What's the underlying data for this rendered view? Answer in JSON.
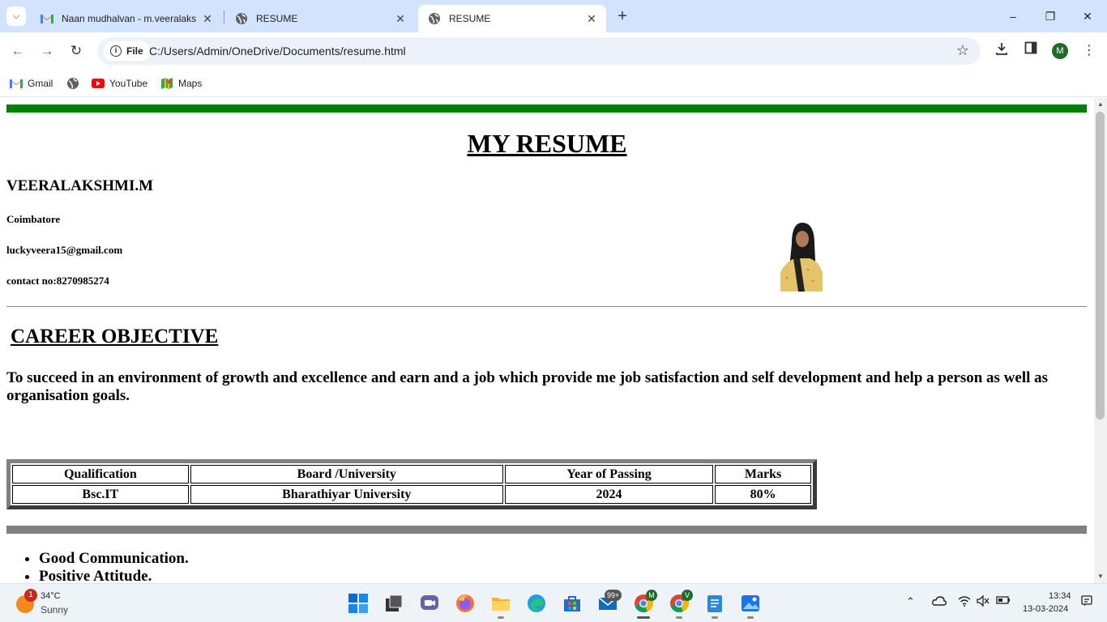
{
  "browser": {
    "tabs": [
      {
        "title": "Naan mudhalvan - m.veeralaksh",
        "favicon": "gmail-icon",
        "active": false
      },
      {
        "title": "RESUME",
        "favicon": "globe-icon",
        "active": false
      },
      {
        "title": "RESUME",
        "favicon": "globe-icon",
        "active": true
      }
    ],
    "omnibox": {
      "chip_label": "File",
      "url": "C:/Users/Admin/OneDrive/Documents/resume.html"
    },
    "profile_initial": "M",
    "bookmarks": [
      {
        "label": "Gmail",
        "icon": "gmail-icon"
      },
      {
        "label": "",
        "icon": "globe-icon"
      },
      {
        "label": "YouTube",
        "icon": "youtube-icon"
      },
      {
        "label": "Maps",
        "icon": "maps-icon"
      }
    ]
  },
  "resume": {
    "title": "MY RESUME",
    "name": "VEERALAKSHMI.M",
    "city": "Coimbatore",
    "email": "luckyveera15@gmail.com",
    "contact": "contact no:8270985274",
    "career_heading": "CAREER OBJECTIVE",
    "objective": "To succeed in an environment of growth and excellence and earn and a job which provide me job satisfaction and self development and help a person as well as organisation goals.",
    "table": {
      "headers": [
        "Qualification",
        "Board /University",
        "Year of Passing",
        "Marks"
      ],
      "rows": [
        [
          "Bsc.IT",
          "Bharathiyar University",
          "2024",
          "80%"
        ]
      ]
    },
    "skills": [
      "Good Communication.",
      "Positive Attitude."
    ],
    "colors": {
      "top_rule": "#008000",
      "bottom_rule": "#808080"
    }
  },
  "taskbar": {
    "weather": {
      "badge": "1",
      "temp": "34°C",
      "desc": "Sunny"
    },
    "mail_badge": "99+",
    "chrome1_badge": "M",
    "chrome2_badge": "V",
    "time": "13:34",
    "date": "13-03-2024"
  }
}
